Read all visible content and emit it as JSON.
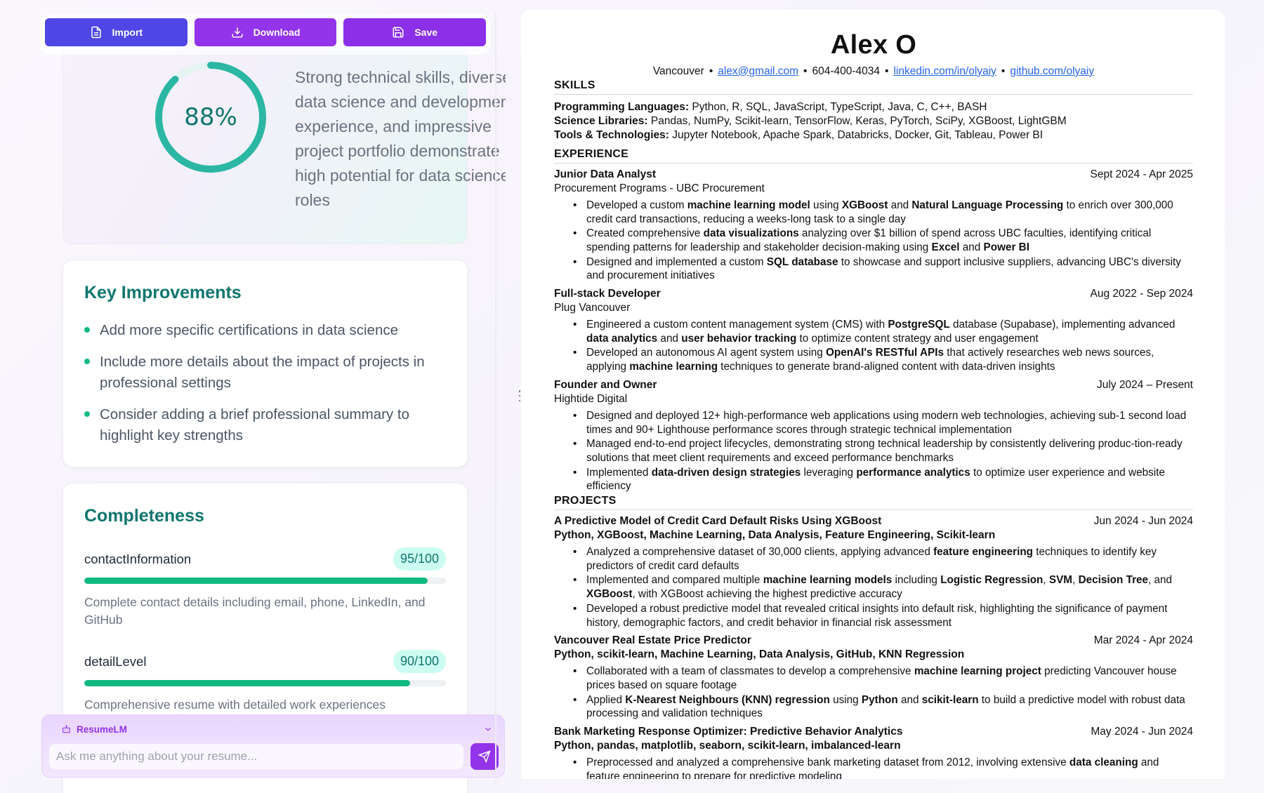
{
  "toolbar": {
    "import_label": "Import",
    "download_label": "Download",
    "save_label": "Save"
  },
  "score": {
    "value": 88,
    "label": "88%",
    "summary": "Strong technical skills, diverse data science and development experience, and impressive project portfolio demonstrate high potential for data science roles",
    "ring_color": "#2bb7a3"
  },
  "improvements": {
    "title": "Key Improvements",
    "items": [
      "Add more specific certifications in data science",
      "Include more details about the impact of projects in professional settings",
      "Consider adding a brief professional summary to highlight key strengths"
    ]
  },
  "completeness": {
    "title": "Completeness",
    "metrics": [
      {
        "name": "contactInformation",
        "score": "95/100",
        "value": 95,
        "description": "Complete contact details including email, phone, LinkedIn, and GitHub"
      },
      {
        "name": "detailLevel",
        "score": "90/100",
        "value": 90,
        "description": "Comprehensive resume with detailed work experiences"
      }
    ]
  },
  "chat": {
    "title": "ResumeLM",
    "placeholder": "Ask me anything about your resume..."
  },
  "resume": {
    "name": "Alex O",
    "location": "Vancouver",
    "email": "alex@gmail.com",
    "phone": "604-400-4034",
    "linkedin": "linkedin.com/in/olyaiy",
    "github": "github.com/olyaiy",
    "sections": {
      "skills": "SKILLS",
      "experience": "EXPERIENCE",
      "projects": "PROJECTS"
    },
    "skills": [
      {
        "label": "Programming Languages:",
        "value": "Python, R, SQL, JavaScript, TypeScript, Java, C, C++, BASH"
      },
      {
        "label": "Science Libraries:",
        "value": "Pandas, NumPy, Scikit-learn, TensorFlow, Keras, PyTorch, SciPy, XGBoost, LightGBM"
      },
      {
        "label": "Tools & Technologies:",
        "value": "Jupyter Notebook, Apache Spark, Databricks, Docker, Git, Tableau, Power BI"
      }
    ],
    "experience": [
      {
        "title": "Junior Data Analyst",
        "date": "Sept 2024 - Apr 2025",
        "company": "Procurement Programs - UBC Procurement",
        "bullets": [
          [
            [
              "Developed a custom ",
              0
            ],
            [
              "machine learning model",
              1
            ],
            [
              " using ",
              0
            ],
            [
              "XGBoost",
              1
            ],
            [
              " and ",
              0
            ],
            [
              "Natural Language Processing",
              1
            ],
            [
              " to enrich over 300,000 credit card transactions, reducing a weeks-long task to a single day",
              0
            ]
          ],
          [
            [
              "Created comprehensive ",
              0
            ],
            [
              "data visualizations",
              1
            ],
            [
              " analyzing over $1 billion of spend across UBC faculties, identifying critical spending patterns for leadership and stakeholder decision-making using ",
              0
            ],
            [
              "Excel",
              1
            ],
            [
              " and ",
              0
            ],
            [
              "Power BI",
              1
            ]
          ],
          [
            [
              "Designed and implemented a custom ",
              0
            ],
            [
              "SQL database",
              1
            ],
            [
              " to showcase and support inclusive suppliers, advancing UBC's diversity and procurement initiatives",
              0
            ]
          ]
        ]
      },
      {
        "title": "Full-stack Developer",
        "date": "Aug 2022 - Sep 2024",
        "company": "Plug Vancouver",
        "bullets": [
          [
            [
              "Engineered a custom content management system (CMS) with ",
              0
            ],
            [
              "PostgreSQL",
              1
            ],
            [
              " database (Supabase), implementing advanced ",
              0
            ],
            [
              "data analytics",
              1
            ],
            [
              " and ",
              0
            ],
            [
              "user behavior tracking",
              1
            ],
            [
              " to optimize content strategy and user engagement",
              0
            ]
          ],
          [
            [
              "Developed an autonomous AI agent system using ",
              0
            ],
            [
              "OpenAI's RESTful APIs",
              1
            ],
            [
              " that actively researches web news sources, applying ",
              0
            ],
            [
              "machine learning",
              1
            ],
            [
              " techniques to generate brand-aligned content with data-driven insights",
              0
            ]
          ]
        ]
      },
      {
        "title": "Founder and Owner",
        "date": "July 2024 – Present",
        "company": "Hightide Digital",
        "bullets": [
          [
            [
              "Designed and deployed 12+ high-performance web applications using modern web technologies, achieving sub-1 second load times and 90+ Lighthouse performance scores through strategic technical implementation",
              0
            ]
          ],
          [
            [
              "Managed end-to-end project lifecycles, demonstrating strong technical leadership by consistently delivering produc-tion-ready solutions that meet client requirements and exceed performance benchmarks",
              0
            ]
          ],
          [
            [
              "Implemented ",
              0
            ],
            [
              "data-driven design strategies",
              1
            ],
            [
              " leveraging ",
              0
            ],
            [
              "performance analytics",
              1
            ],
            [
              " to optimize user experience and website efficiency",
              0
            ]
          ]
        ]
      }
    ],
    "projects": [
      {
        "title": "A Predictive Model of Credit Card Default Risks Using XGBoost",
        "date": "Jun 2024 - Jun 2024",
        "tech": "Python, XGBoost, Machine Learning, Data Analysis, Feature Engineering, Scikit-learn",
        "bullets": [
          [
            [
              "Analyzed a comprehensive dataset of 30,000 clients, applying advanced ",
              0
            ],
            [
              "feature engineering",
              1
            ],
            [
              " techniques to identify key predictors of credit card defaults",
              0
            ]
          ],
          [
            [
              "Implemented and compared multiple ",
              0
            ],
            [
              "machine learning models",
              1
            ],
            [
              " including ",
              0
            ],
            [
              "Logistic Regression",
              1
            ],
            [
              ", ",
              0
            ],
            [
              "SVM",
              1
            ],
            [
              ", ",
              0
            ],
            [
              "Decision Tree",
              1
            ],
            [
              ", and ",
              0
            ],
            [
              "XGBoost",
              1
            ],
            [
              ", with XGBoost achieving the highest predictive accuracy",
              0
            ]
          ],
          [
            [
              "Developed a robust predictive model that revealed critical insights into default risk, highlighting the significance of payment history, demographic factors, and credit behavior in financial risk assessment",
              0
            ]
          ]
        ]
      },
      {
        "title": "Vancouver Real Estate Price Predictor",
        "date": "Mar 2024 - Apr 2024",
        "tech": "Python, scikit-learn, Machine Learning, Data Analysis, GitHub, KNN Regression",
        "bullets": [
          [
            [
              "Collaborated with a team of classmates to develop a comprehensive ",
              0
            ],
            [
              "machine learning project",
              1
            ],
            [
              " predicting Vancouver house prices based on square footage",
              0
            ]
          ],
          [
            [
              "Applied ",
              0
            ],
            [
              "K-Nearest Neighbours (KNN) regression",
              1
            ],
            [
              " using ",
              0
            ],
            [
              "Python",
              1
            ],
            [
              " and ",
              0
            ],
            [
              "scikit-learn",
              1
            ],
            [
              " to build a predictive model with robust data processing and validation techniques",
              0
            ]
          ]
        ]
      },
      {
        "title": "Bank Marketing Response Optimizer: Predictive Behavior Analytics",
        "date": "May 2024 - Jun 2024",
        "tech": "Python, pandas, matplotlib, seaborn, scikit-learn, imbalanced-learn",
        "bullets": [
          [
            [
              "Preprocessed and analyzed a comprehensive bank marketing dataset from 2012, involving extensive ",
              0
            ],
            [
              "data cleaning",
              1
            ],
            [
              " and feature engineering to prepare for predictive modeling",
              0
            ]
          ]
        ]
      }
    ]
  }
}
